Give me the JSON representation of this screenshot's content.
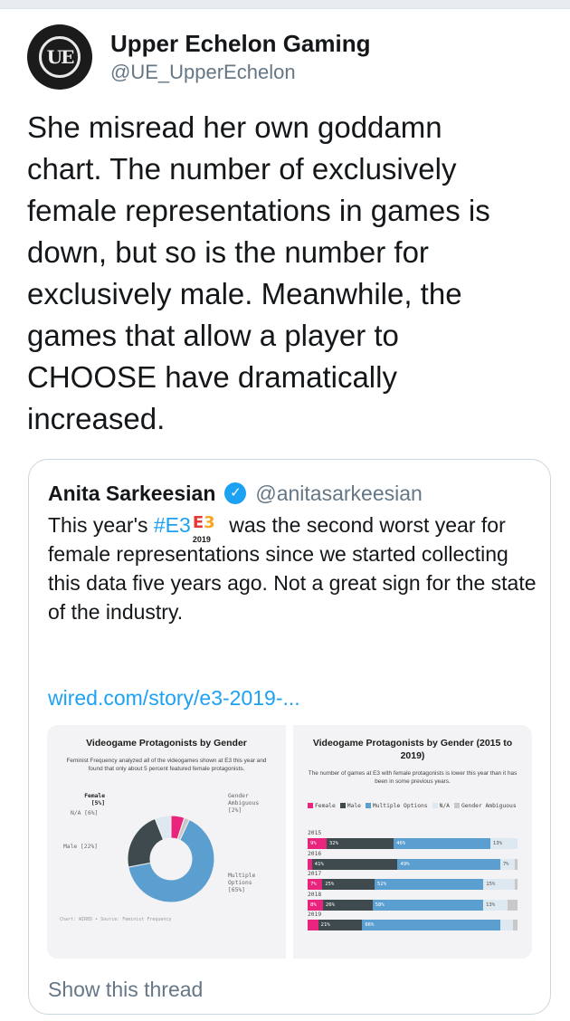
{
  "tweet": {
    "author_name": "Upper Echelon Gaming",
    "author_handle": "@UE_UpperEchelon",
    "avatar_text": "UE",
    "text": "She misread her own goddamn\nchart. The number of exclusively\nfemale representations in games is\ndown, but so is the number for\nexclusively male. Meanwhile, the\ngames that allow a player to\nCHOOSE have dramatically\nincreased."
  },
  "quote": {
    "author_name": "Anita Sarkeesian",
    "verified_glyph": "✓",
    "author_handle": "@anitasarkeesian",
    "text_before": "This year's ",
    "hashtag": "#E3",
    "e3_badge": {
      "letters": "E",
      "digit": "3",
      "year": "2019"
    },
    "text_after": " was the second worst year for female representations since we started collecting this data five years ago. Not a great sign for the state of the industry.",
    "link": "wired.com/story/e3-2019-...",
    "show_thread": "Show this thread"
  },
  "colors": {
    "female": "#e8247c",
    "male": "#3f4a4f",
    "multiple": "#5b9fd1",
    "na": "#dde8f0",
    "ambiguous": "#c8c8c8",
    "link": "#1da1f2"
  },
  "chart_data": [
    {
      "type": "pie",
      "title": "Videogame Protagonists by Gender",
      "subtitle": "Feminist Frequency analyzed all of the videogames shown at E3 this year and found that only about 5 percent featured female protagonists.",
      "credit": "Chart: WIRED • Source: Feminist Frequency",
      "slices": [
        {
          "name": "Female",
          "label": "Female",
          "value_label": "[5%]",
          "value": 5
        },
        {
          "name": "Gender Ambiguous",
          "label": "Gender\nAmbiguous",
          "value_label": "[2%]",
          "value": 2
        },
        {
          "name": "Multiple Options",
          "label": "Multiple\nOptions",
          "value_label": "[65%]",
          "value": 65
        },
        {
          "name": "Male",
          "label": "Male [22%]",
          "value": 22
        },
        {
          "name": "N/A",
          "label": "N/A [6%]",
          "value": 6
        }
      ]
    },
    {
      "type": "bar",
      "stacked": true,
      "orientation": "horizontal",
      "title": "Videogame Protagonists by Gender (2015 to 2019)",
      "subtitle": "The number of games at E3 with female protagonists is lower this year than it has been in some previous years.",
      "legend": [
        {
          "name": "Female",
          "key": "female"
        },
        {
          "name": "Male",
          "key": "male"
        },
        {
          "name": "Multiple Options",
          "key": "multiple"
        },
        {
          "name": "N/A",
          "key": "na"
        },
        {
          "name": "Gender Ambiguous",
          "key": "ambiguous"
        }
      ],
      "categories": [
        "2015",
        "2016",
        "2017",
        "2018",
        "2019"
      ],
      "series": [
        {
          "name": "Female",
          "key": "female",
          "values": [
            9,
            2,
            7,
            8,
            5
          ],
          "labels": [
            "9%",
            "",
            "7%",
            "8%",
            ""
          ]
        },
        {
          "name": "Male",
          "key": "male",
          "values": [
            32,
            41,
            25,
            26,
            21
          ],
          "labels": [
            "32%",
            "41%",
            "25%",
            "26%",
            "21%"
          ]
        },
        {
          "name": "Multiple Options",
          "key": "multiple",
          "values": [
            46,
            49,
            52,
            58,
            66
          ],
          "labels": [
            "46%",
            "49%",
            "52%",
            "58%",
            "66%"
          ]
        },
        {
          "name": "N/A",
          "key": "na",
          "values": [
            13,
            7,
            15,
            13,
            6
          ],
          "labels": [
            "13%",
            "7%",
            "15%",
            "13%",
            ""
          ]
        },
        {
          "name": "Gender Ambiguous",
          "key": "ambiguous",
          "values": [
            0,
            1,
            1,
            5,
            2
          ],
          "labels": [
            "",
            "",
            "",
            "",
            ""
          ]
        }
      ]
    }
  ]
}
